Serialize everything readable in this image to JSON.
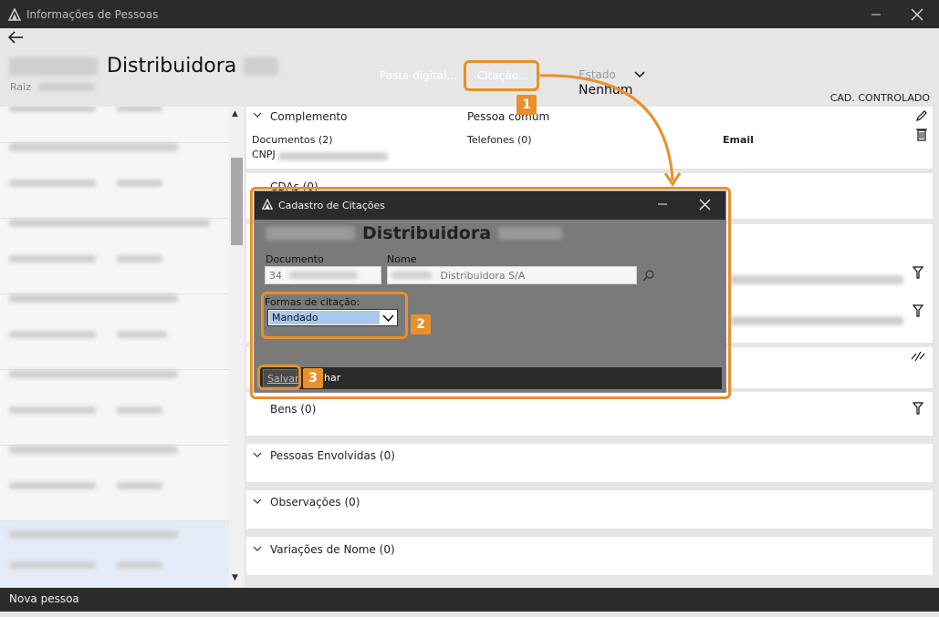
{
  "window": {
    "title": "Informações de Pessoas"
  },
  "header": {
    "name": "Distribuidora",
    "raiz_label": "Raiz",
    "pasta_digital": "Pasta digital...",
    "citacao": "Citação...",
    "estado_label": "Estado",
    "estado_value": "Nenhum",
    "cad_controlado": "CAD. CONTROLADO"
  },
  "main": {
    "complemento": "Complemento",
    "pessoa_comum": "Pessoa comum",
    "documentos": "Documentos (2)",
    "telefones": "Telefones (0)",
    "email": "Email",
    "cnpj": "CNPJ",
    "cdas": "CDAs (0)",
    "bens": "Bens (0)",
    "pessoas_envolvidas": "Pessoas Envolvidas (0)",
    "observacoes": "Observações (0)",
    "variacoes": "Variações de Nome (0)"
  },
  "dialog": {
    "title": "Cadastro de Citações",
    "name": "Distribuidora",
    "documento_label": "Documento",
    "documento_value": "34",
    "nome_label": "Nome",
    "nome_value": "Distribuidora S/A",
    "formas_label": "Formas de citação:",
    "formas_value": "Mandado",
    "salvar": "Salvar",
    "fechar": "har"
  },
  "footer": {
    "nova_pessoa": "Nova pessoa"
  },
  "steps": [
    "1",
    "2",
    "3"
  ],
  "colors": {
    "accent": "#e8902a",
    "titlebar": "#2b2b2b",
    "selection": "#a9c8ee"
  }
}
